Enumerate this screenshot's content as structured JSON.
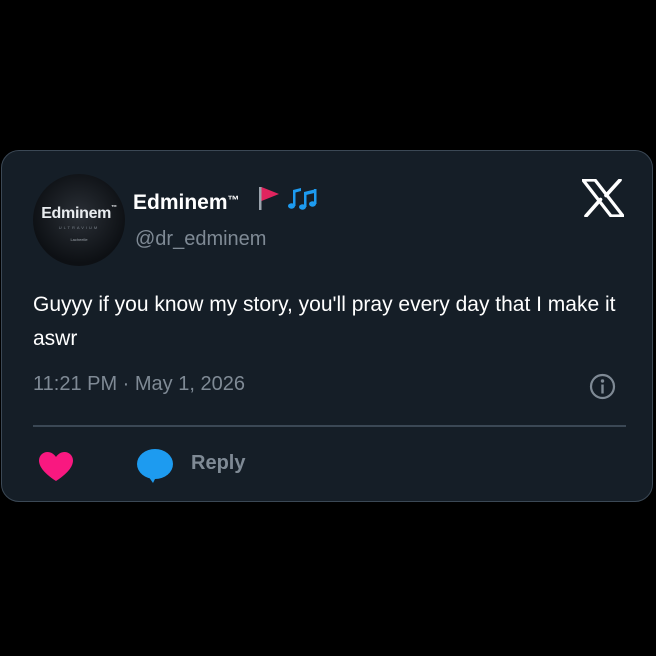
{
  "tweet": {
    "avatar": {
      "brand": "Edminem",
      "brand_mark": "™",
      "sub": "ULTRAVIUM",
      "small": "Lacheelle"
    },
    "display_name": "Edminem",
    "display_name_mark": "™",
    "name_icons": [
      "red-flag-icon",
      "musical-notes-icon"
    ],
    "handle": "@dr_edminem",
    "text": "Guyyy if you know my story, you'll pray every day that I make it aswr",
    "timestamp": "11:21 PM · May 1, 2026",
    "reply_label": "Reply",
    "brand_icon": "x-logo-icon",
    "colors": {
      "background": "#000000",
      "card": "#151e27",
      "border": "#3b4855",
      "muted": "#7f8a95",
      "heart": "#f91880",
      "reply": "#1d9bf0",
      "flag": "#e0245e"
    }
  }
}
